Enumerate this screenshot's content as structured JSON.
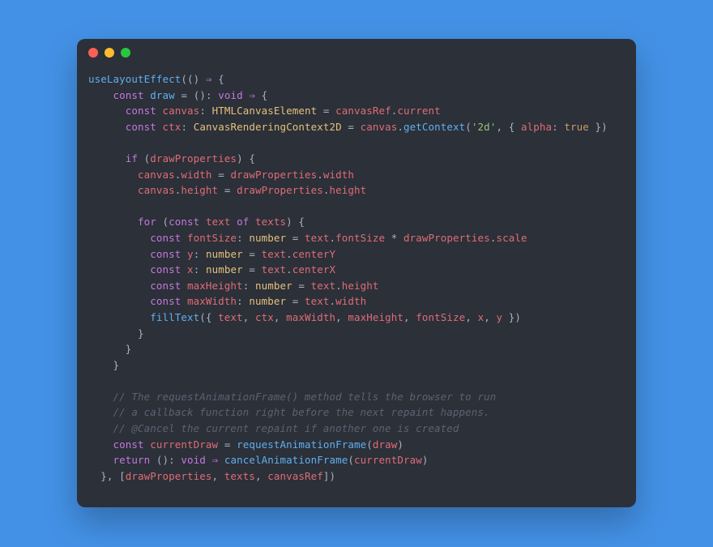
{
  "window": {
    "kind": "code-editor"
  },
  "code": {
    "lines": [
      [
        [
          "fn",
          "useLayoutEffect"
        ],
        [
          "pu",
          "(() "
        ],
        [
          "kw",
          "⇒"
        ],
        [
          "pu",
          " {"
        ]
      ],
      [
        [
          "pu",
          "    "
        ],
        [
          "kw",
          "const"
        ],
        [
          "pu",
          " "
        ],
        [
          "fn",
          "draw"
        ],
        [
          "pu",
          " = (): "
        ],
        [
          "kw",
          "void"
        ],
        [
          "pu",
          " "
        ],
        [
          "kw",
          "⇒"
        ],
        [
          "pu",
          " {"
        ]
      ],
      [
        [
          "pu",
          "      "
        ],
        [
          "kw",
          "const"
        ],
        [
          "pu",
          " "
        ],
        [
          "pr",
          "canvas"
        ],
        [
          "pu",
          ": "
        ],
        [
          "ty",
          "HTMLCanvasElement"
        ],
        [
          "pu",
          " = "
        ],
        [
          "pr",
          "canvasRef"
        ],
        [
          "pu",
          "."
        ],
        [
          "pr",
          "current"
        ]
      ],
      [
        [
          "pu",
          "      "
        ],
        [
          "kw",
          "const"
        ],
        [
          "pu",
          " "
        ],
        [
          "pr",
          "ctx"
        ],
        [
          "pu",
          ": "
        ],
        [
          "ty",
          "CanvasRenderingContext2D"
        ],
        [
          "pu",
          " = "
        ],
        [
          "pr",
          "canvas"
        ],
        [
          "pu",
          "."
        ],
        [
          "fn",
          "getContext"
        ],
        [
          "pu",
          "("
        ],
        [
          "st",
          "'2d'"
        ],
        [
          "pu",
          ", { "
        ],
        [
          "pr",
          "alpha"
        ],
        [
          "pu",
          ": "
        ],
        [
          "vl",
          "true"
        ],
        [
          "pu",
          " })"
        ]
      ],
      [],
      [
        [
          "pu",
          "      "
        ],
        [
          "kw",
          "if"
        ],
        [
          "pu",
          " ("
        ],
        [
          "pr",
          "drawProperties"
        ],
        [
          "pu",
          ") {"
        ]
      ],
      [
        [
          "pu",
          "        "
        ],
        [
          "pr",
          "canvas"
        ],
        [
          "pu",
          "."
        ],
        [
          "pr",
          "width"
        ],
        [
          "pu",
          " = "
        ],
        [
          "pr",
          "drawProperties"
        ],
        [
          "pu",
          "."
        ],
        [
          "pr",
          "width"
        ]
      ],
      [
        [
          "pu",
          "        "
        ],
        [
          "pr",
          "canvas"
        ],
        [
          "pu",
          "."
        ],
        [
          "pr",
          "height"
        ],
        [
          "pu",
          " = "
        ],
        [
          "pr",
          "drawProperties"
        ],
        [
          "pu",
          "."
        ],
        [
          "pr",
          "height"
        ]
      ],
      [],
      [
        [
          "pu",
          "        "
        ],
        [
          "kw",
          "for"
        ],
        [
          "pu",
          " ("
        ],
        [
          "kw",
          "const"
        ],
        [
          "pu",
          " "
        ],
        [
          "pr",
          "text"
        ],
        [
          "pu",
          " "
        ],
        [
          "kw",
          "of"
        ],
        [
          "pu",
          " "
        ],
        [
          "pr",
          "texts"
        ],
        [
          "pu",
          ") {"
        ]
      ],
      [
        [
          "pu",
          "          "
        ],
        [
          "kw",
          "const"
        ],
        [
          "pu",
          " "
        ],
        [
          "pr",
          "fontSize"
        ],
        [
          "pu",
          ": "
        ],
        [
          "ty",
          "number"
        ],
        [
          "pu",
          " = "
        ],
        [
          "pr",
          "text"
        ],
        [
          "pu",
          "."
        ],
        [
          "pr",
          "fontSize"
        ],
        [
          "pu",
          " * "
        ],
        [
          "pr",
          "drawProperties"
        ],
        [
          "pu",
          "."
        ],
        [
          "pr",
          "scale"
        ]
      ],
      [
        [
          "pu",
          "          "
        ],
        [
          "kw",
          "const"
        ],
        [
          "pu",
          " "
        ],
        [
          "pr",
          "y"
        ],
        [
          "pu",
          ": "
        ],
        [
          "ty",
          "number"
        ],
        [
          "pu",
          " = "
        ],
        [
          "pr",
          "text"
        ],
        [
          "pu",
          "."
        ],
        [
          "pr",
          "centerY"
        ]
      ],
      [
        [
          "pu",
          "          "
        ],
        [
          "kw",
          "const"
        ],
        [
          "pu",
          " "
        ],
        [
          "pr",
          "x"
        ],
        [
          "pu",
          ": "
        ],
        [
          "ty",
          "number"
        ],
        [
          "pu",
          " = "
        ],
        [
          "pr",
          "text"
        ],
        [
          "pu",
          "."
        ],
        [
          "pr",
          "centerX"
        ]
      ],
      [
        [
          "pu",
          "          "
        ],
        [
          "kw",
          "const"
        ],
        [
          "pu",
          " "
        ],
        [
          "pr",
          "maxHeight"
        ],
        [
          "pu",
          ": "
        ],
        [
          "ty",
          "number"
        ],
        [
          "pu",
          " = "
        ],
        [
          "pr",
          "text"
        ],
        [
          "pu",
          "."
        ],
        [
          "pr",
          "height"
        ]
      ],
      [
        [
          "pu",
          "          "
        ],
        [
          "kw",
          "const"
        ],
        [
          "pu",
          " "
        ],
        [
          "pr",
          "maxWidth"
        ],
        [
          "pu",
          ": "
        ],
        [
          "ty",
          "number"
        ],
        [
          "pu",
          " = "
        ],
        [
          "pr",
          "text"
        ],
        [
          "pu",
          "."
        ],
        [
          "pr",
          "width"
        ]
      ],
      [
        [
          "pu",
          "          "
        ],
        [
          "fn",
          "fillText"
        ],
        [
          "pu",
          "({ "
        ],
        [
          "pr",
          "text"
        ],
        [
          "pu",
          ", "
        ],
        [
          "pr",
          "ctx"
        ],
        [
          "pu",
          ", "
        ],
        [
          "pr",
          "maxWidth"
        ],
        [
          "pu",
          ", "
        ],
        [
          "pr",
          "maxHeight"
        ],
        [
          "pu",
          ", "
        ],
        [
          "pr",
          "fontSize"
        ],
        [
          "pu",
          ", "
        ],
        [
          "pr",
          "x"
        ],
        [
          "pu",
          ", "
        ],
        [
          "pr",
          "y"
        ],
        [
          "pu",
          " })"
        ]
      ],
      [
        [
          "pu",
          "        }"
        ]
      ],
      [
        [
          "pu",
          "      }"
        ]
      ],
      [
        [
          "pu",
          "    }"
        ]
      ],
      [],
      [
        [
          "pu",
          "    "
        ],
        [
          "cm",
          "// The requestAnimationFrame() method tells the browser to run"
        ]
      ],
      [
        [
          "pu",
          "    "
        ],
        [
          "cm",
          "// a callback function right before the next repaint happens."
        ]
      ],
      [
        [
          "pu",
          "    "
        ],
        [
          "cm",
          "// @Cancel the current repaint if another one is created"
        ]
      ],
      [
        [
          "pu",
          "    "
        ],
        [
          "kw",
          "const"
        ],
        [
          "pu",
          " "
        ],
        [
          "pr",
          "currentDraw"
        ],
        [
          "pu",
          " = "
        ],
        [
          "fn",
          "requestAnimationFrame"
        ],
        [
          "pu",
          "("
        ],
        [
          "pr",
          "draw"
        ],
        [
          "pu",
          ")"
        ]
      ],
      [
        [
          "pu",
          "    "
        ],
        [
          "kw",
          "return"
        ],
        [
          "pu",
          " (): "
        ],
        [
          "kw",
          "void"
        ],
        [
          "pu",
          " "
        ],
        [
          "kw",
          "⇒"
        ],
        [
          "pu",
          " "
        ],
        [
          "fn",
          "cancelAnimationFrame"
        ],
        [
          "pu",
          "("
        ],
        [
          "pr",
          "currentDraw"
        ],
        [
          "pu",
          ")"
        ]
      ],
      [
        [
          "pu",
          "  }, ["
        ],
        [
          "pr",
          "drawProperties"
        ],
        [
          "pu",
          ", "
        ],
        [
          "pr",
          "texts"
        ],
        [
          "pu",
          ", "
        ],
        [
          "pr",
          "canvasRef"
        ],
        [
          "pu",
          "])"
        ]
      ]
    ]
  }
}
